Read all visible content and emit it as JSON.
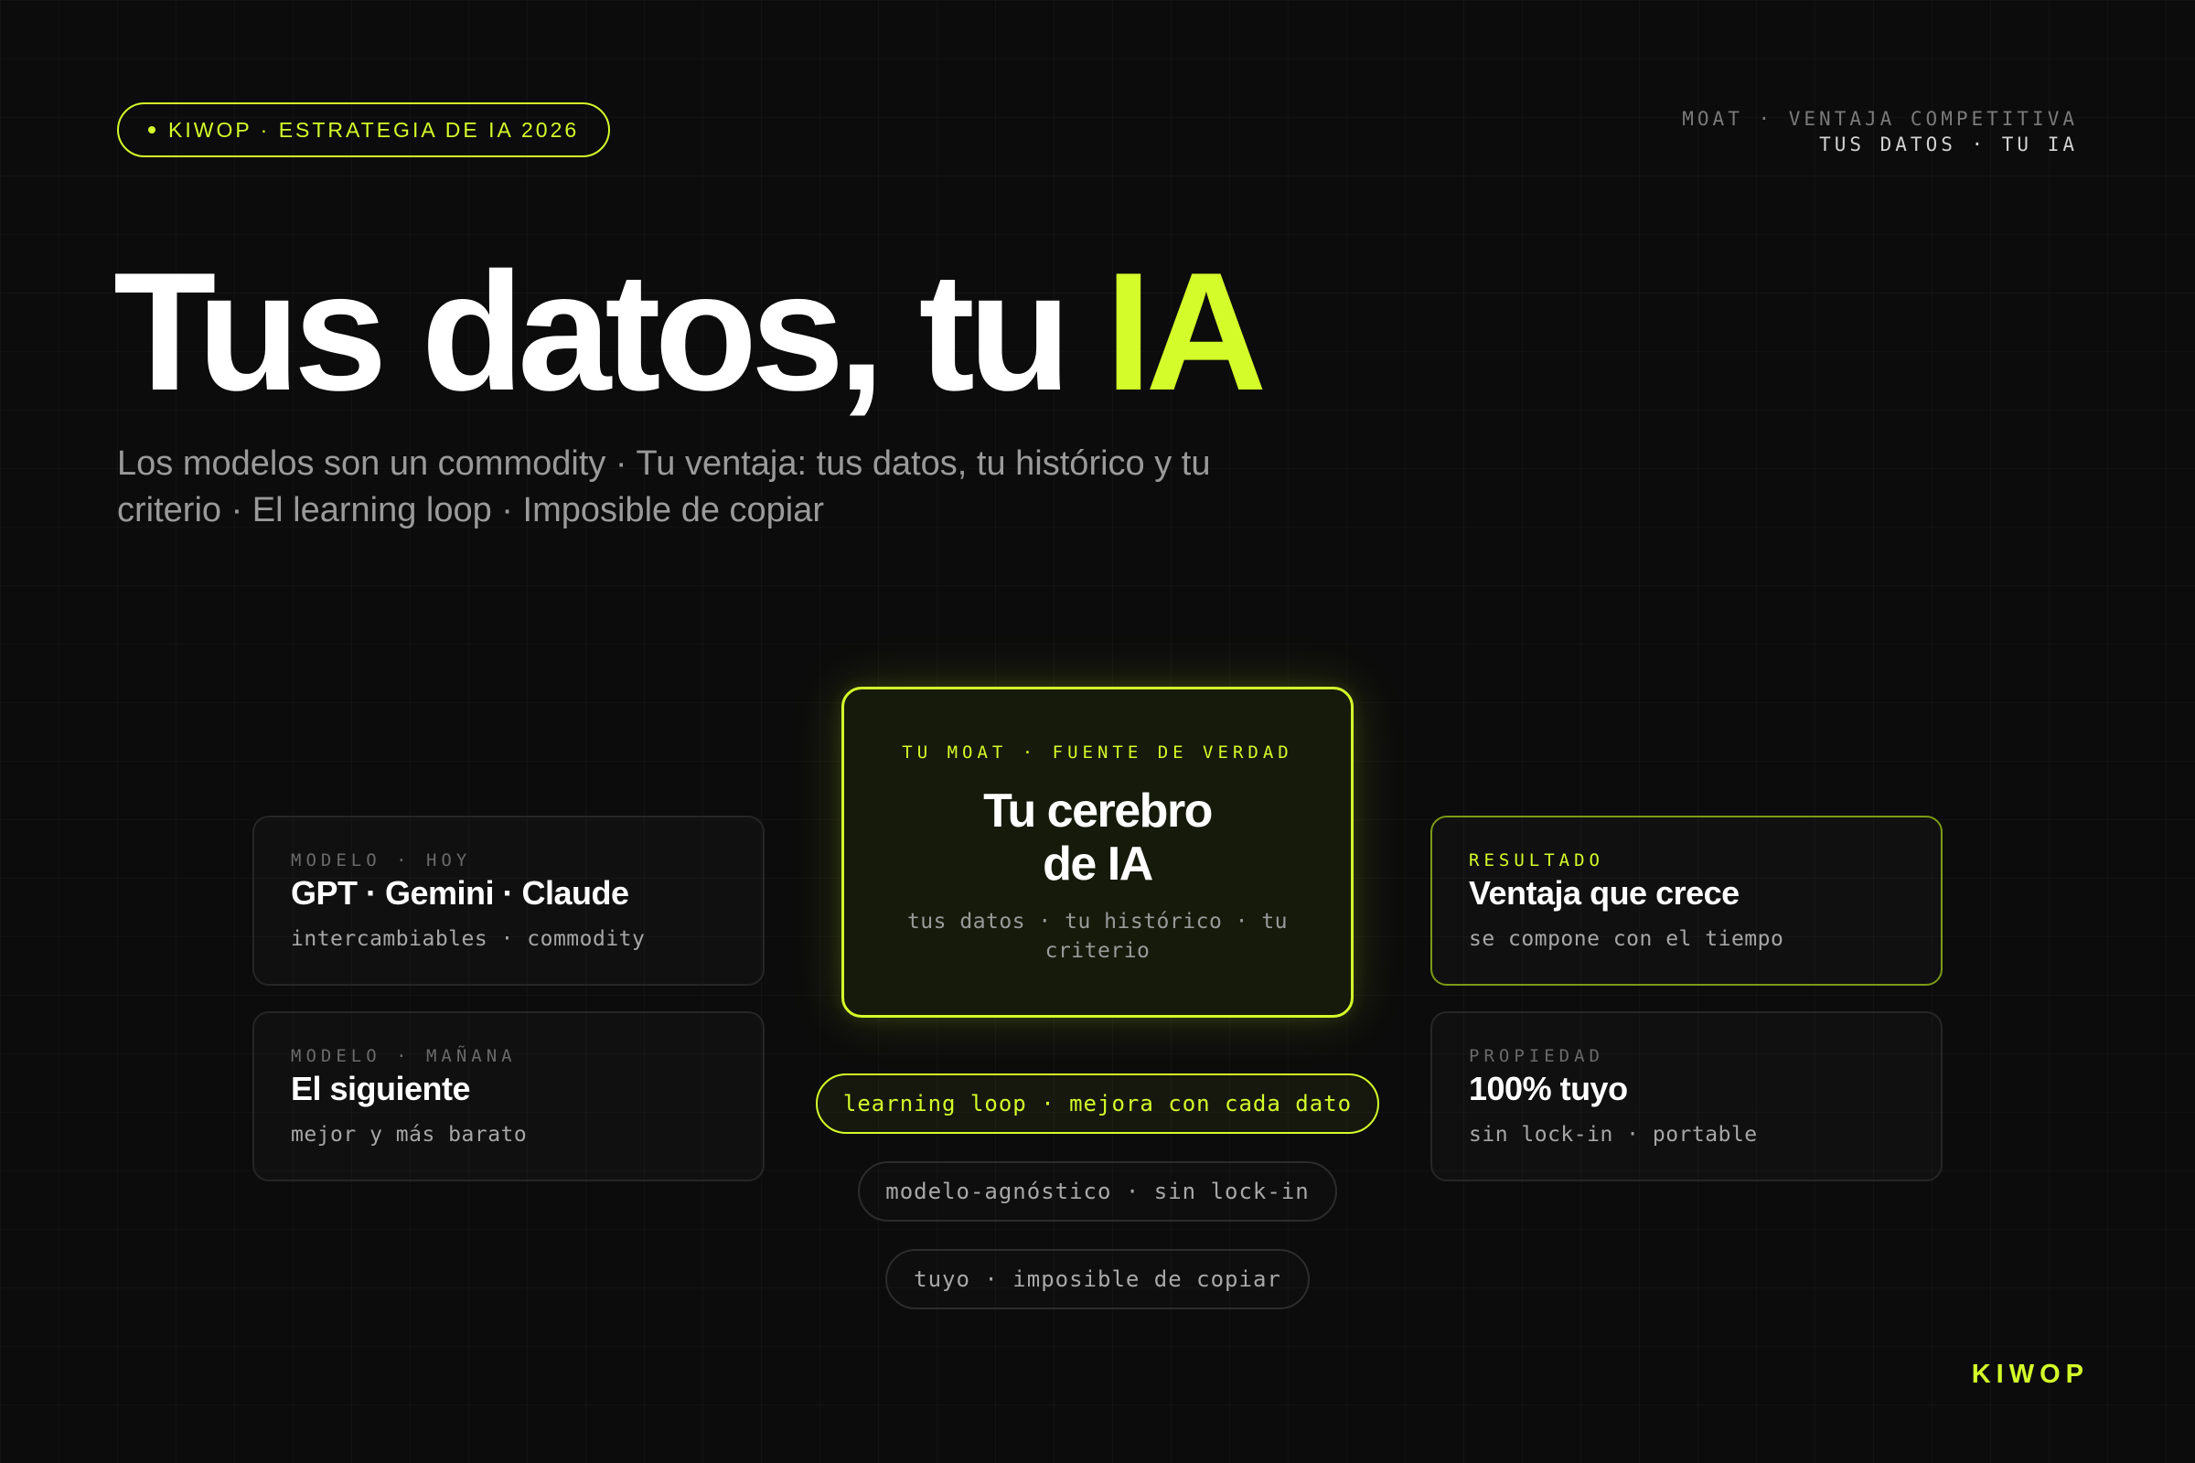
{
  "header": {
    "pill_label": "KIWOP · ESTRATEGIA DE IA 2026",
    "meta_line1": "MOAT · VENTAJA COMPETITIVA",
    "meta_line2": "TUS DATOS · TU IA"
  },
  "hero": {
    "title_main": "Tus datos, tu ",
    "title_accent": "IA",
    "subtitle": "Los modelos son un commodity · Tu ventaja: tus datos, tu histórico y tu criterio · El learning loop · Imposible de copiar"
  },
  "cards": {
    "model_today": {
      "eyebrow": "MODELO · HOY",
      "title": "GPT · Gemini · Claude",
      "desc": "intercambiables · commodity"
    },
    "model_tomorrow": {
      "eyebrow": "MODELO · MAÑANA",
      "title": "El siguiente",
      "desc": "mejor y más barato"
    },
    "result": {
      "eyebrow": "RESULTADO",
      "title": "Ventaja que crece",
      "desc": "se compone con el tiempo"
    },
    "ownership": {
      "eyebrow": "PROPIEDAD",
      "title": "100% tuyo",
      "desc": "sin lock-in · portable"
    }
  },
  "hub": {
    "eyebrow": "TU MOAT · FUENTE DE VERDAD",
    "title_line1": "Tu cerebro",
    "title_line2": "de IA",
    "desc": "tus datos · tu histórico · tu criterio"
  },
  "tags": {
    "learning_loop": "learning loop · mejora con cada dato",
    "model_agnostic": "modelo-agnóstico · sin lock-in",
    "yours": "tuyo · imposible de copiar"
  },
  "footer": {
    "brand": "KIWOP"
  },
  "colors": {
    "accent": "#d4fb2a",
    "background": "#0c0c0c"
  }
}
